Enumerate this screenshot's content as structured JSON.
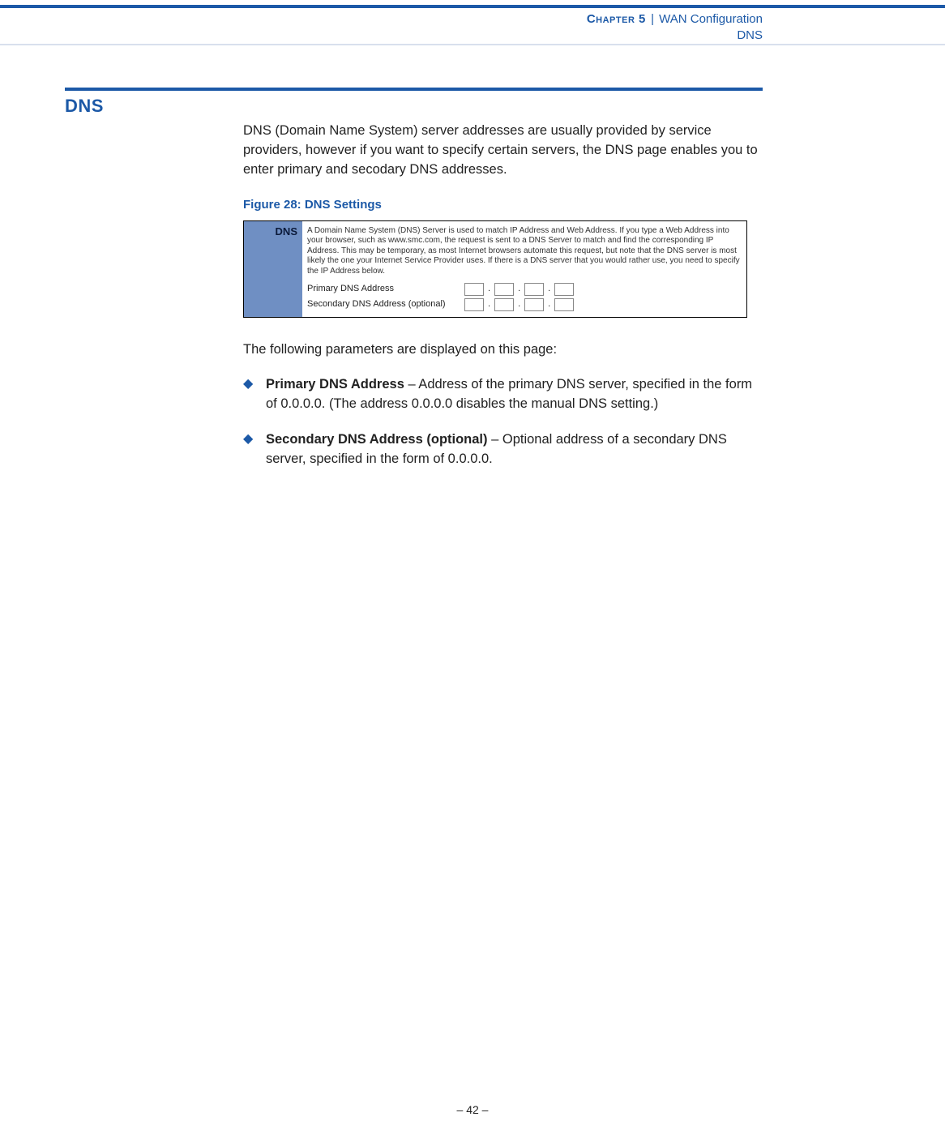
{
  "header": {
    "chapter_prefix": "Chapter 5",
    "separator": "|",
    "chapter_title": "WAN Configuration",
    "subsection": "DNS"
  },
  "section": {
    "title": "DNS"
  },
  "intro_paragraph": "DNS (Domain Name System) server addresses are usually provided by service providers, however if you want to specify certain servers, the DNS page enables you to enter primary and secodary DNS addresses.",
  "figure": {
    "caption": "Figure 28:  DNS Settings",
    "side_label": "DNS",
    "description": "A Domain Name System (DNS) Server is used to match IP Address and Web Address. If you type a Web Address into your browser, such as www.smc.com, the request is sent to a DNS Server to match and find the corresponding IP Address. This may be temporary, as most Internet browsers automate this request, but note that the DNS server is most likely the one your Internet Service Provider uses. If there is a DNS server that you would rather use, you need to specify the IP Address below.",
    "row1_label": "Primary DNS Address",
    "row2_label": "Secondary DNS Address (optional)"
  },
  "followup_text": "The following parameters are displayed on this page:",
  "bullets": [
    {
      "title": "Primary DNS Address",
      "rest": " – Address of the primary DNS server, specified in the form of 0.0.0.0. (The address 0.0.0.0 disables the manual DNS setting.)"
    },
    {
      "title": "Secondary DNS Address (optional)",
      "rest": " – Optional address of a secondary DNS server, specified in the form of 0.0.0.0."
    }
  ],
  "page_number": "–  42  –"
}
